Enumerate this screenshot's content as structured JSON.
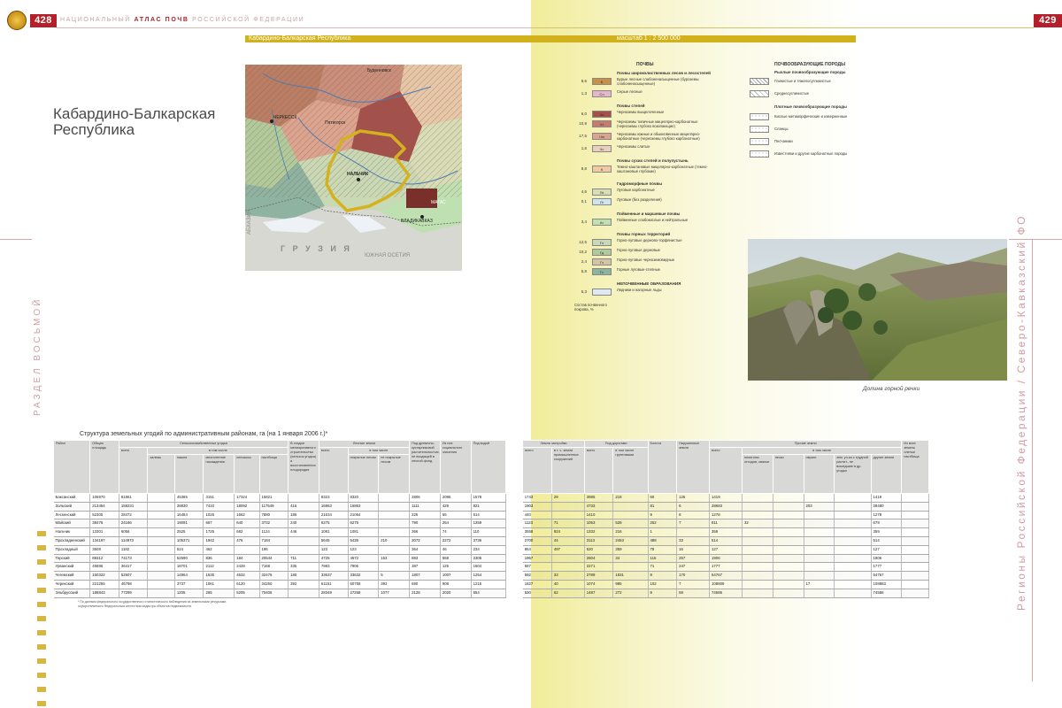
{
  "header": {
    "left_page_number": "428",
    "right_page_number": "429",
    "running_head_pre": "НАЦИОНАЛЬНЫЙ",
    "running_head_bold": "АТЛАС ПОЧВ",
    "running_head_post": "РОССИЙСКОЙ ФЕДЕРАЦИИ"
  },
  "map_bar": {
    "title": "Кабардино-Балкарская Республика",
    "scale": "масштаб 1 : 2 500 000"
  },
  "region_title": "Кабардино-Балкарская Республика",
  "map": {
    "labels": {
      "grusia": "Г Р У З И Я",
      "south_ossetia": "ЮЖНАЯ ОСЕТИЯ",
      "abkhazia": "АБХАЗИЯ",
      "nalchik": "НАЛЬЧИК",
      "cherkessk": "ЧЕРКЕССК",
      "vladikavkaz": "ВЛАДИКАВКАЗ",
      "pyatigorsk": "Пятигорск",
      "budennovsk": "Буденновск",
      "magas": "МАГАС"
    }
  },
  "legend": {
    "title": "ПОЧВЫ",
    "sections": [
      {
        "head": "Почвы широколиственных лесов и лесостепей",
        "items": [
          {
            "num": "8,6",
            "code": "Б",
            "color": "#c98f42",
            "text": "Бурые лесные слабоненасыщенные (буроземы слабоненасыщенные)"
          },
          {
            "num": "1,3",
            "code": "Сл",
            "color": "#e6b7cc",
            "text": "Серые лесные"
          }
        ]
      },
      {
        "head": "Почвы степей",
        "items": [
          {
            "num": "6,0",
            "code": "Чв",
            "color": "#a4514c",
            "text": "Черноземы выщелоченные"
          },
          {
            "num": "10,9",
            "code": "Чт",
            "color": "#c77b6e",
            "text": "Черноземы типичные мицелярно-карбонатные (черноземы глубоко вскипающие)"
          },
          {
            "num": "17,5",
            "code": "Чю",
            "color": "#dba48e",
            "text": "Черноземы южные и обыкновенные мицелярно-карбонатные (черноземы глубоко карбонатные)"
          },
          {
            "num": "1,5",
            "code": "Чс",
            "color": "#ead0bb",
            "text": "Черноземы слитые"
          }
        ]
      },
      {
        "head": "Почвы сухих степей и полупустынь",
        "items": [
          {
            "num": "8,8",
            "code": "К",
            "color": "#f1c9a3",
            "text": "Темно-каштановые мицелярно-карбонатные (темно-каштановые глубокие)"
          }
        ]
      },
      {
        "head": "Гидроморфные почвы",
        "items": [
          {
            "num": "4,6",
            "code": "Лк",
            "color": "#d7ddb7",
            "text": "Луговые карбонатные"
          },
          {
            "num": "0,1",
            "code": "Лг",
            "color": "#cfe4ee",
            "text": "Луговые (без разделения)"
          }
        ]
      },
      {
        "head": "Пойменные и маршевые почвы",
        "items": [
          {
            "num": "3,4",
            "code": "Аг",
            "color": "#bfe0b0",
            "text": "Пойменные слабокислые и нейтральные"
          }
        ]
      },
      {
        "head": "Почвы горных территорий",
        "items": [
          {
            "num": "12,5",
            "code": "Гл",
            "color": "#c9d9b6",
            "text": "Горно-луговые дерново-торфянистые"
          },
          {
            "num": "10,2",
            "code": "Гд",
            "color": "#b0ca9c",
            "text": "Горно-луговые дерновые"
          },
          {
            "num": "2,4",
            "code": "Гч",
            "color": "#d4c6a4",
            "text": "Горно-луговые черноземовидные"
          },
          {
            "num": "5,9",
            "code": "Гс",
            "color": "#8eb3a1",
            "text": "Горные луговые-степные"
          }
        ]
      },
      {
        "head": "НЕПОЧВЕННЫЕ ОБРАЗОВАНИЯ",
        "items": [
          {
            "num": "5,3",
            "code": "",
            "color": "#dfe9f3",
            "text": "Ледники и нагорные льды"
          }
        ]
      }
    ],
    "note": "Состав почвенного покрова, %",
    "right_title": "ПОЧВООБРАЗУЮЩИЕ ПОРОДЫ",
    "right_sub1": "Рыхлые почвообразующие породы",
    "right_items_1": [
      "Глинистые и тяжелосуглинистые",
      "Среднесуглинистые"
    ],
    "right_sub2": "Плотные почвообразующие породы",
    "right_items_2": [
      "Кислые метаморфические и изверженные",
      "Сланцы",
      "Песчаники",
      "Известняки и другие карбонатные породы"
    ]
  },
  "photo": {
    "caption": "Долина горной речки"
  },
  "side": {
    "left": "РАЗДЕЛ ВОСЬМОЙ",
    "right": "Регионы Российской Федерации / Северо-Кавказский ФО"
  },
  "table": {
    "caption": "Структура земельных угодий по административным районам, га (на 1 января 2006 г.)*",
    "headers": {
      "district": "Район",
      "total_area": "Общая площадь",
      "agri": "Сельскохозяйственные угодья",
      "agri_total": "всего",
      "incl": "в том числе",
      "arable": "пашня",
      "fallow": "залежь",
      "perennial": "многолетние насаждения",
      "hayfields": "сенокосы",
      "pastures": "пастбища",
      "construction": "В стадии мелиоративного строительства (сельхоз-угодья) и восстановления плодородия",
      "forest": "Лесные земли",
      "forest_total": "всего",
      "forest_covered": "покрытые лесом",
      "forest_not": "не покрытые лесом",
      "shrubs": "Под древесно-кустарниковой растительностью, не входящей в лесной фонд",
      "social": "Из них социального значения",
      "water": "Под водой",
      "built": "Земли застройки",
      "built_total": "всего",
      "built_industrial": "в т. ч. земли промышленных сооружений",
      "roads": "Под дорогами",
      "roads_total": "всего",
      "roads_dirt": "в том числе грунтовыми",
      "swamps": "Болота",
      "disturbed": "Нарушенные земли",
      "other": "Прочие земли",
      "other_total": "всего",
      "sands": "пески",
      "ravines": "овраги",
      "other_misc": "полигоны отходов, свалки",
      "eroded": "зем. уч-ки с трудной растит., не вошедшие в др. угодья",
      "other_land": "другие земли",
      "all_land": "Из всех земель оленьи пастбища"
    },
    "rows": [
      [
        "Баксанский",
        "106970",
        "81861",
        "",
        "45385",
        "3151",
        "17324",
        "15821",
        "",
        "8323",
        "8320",
        "",
        "2806",
        "2086",
        "1578",
        "",
        "1743",
        "29",
        "3985",
        "218",
        "60",
        "126",
        "1419",
        "",
        "",
        "",
        "",
        "1419",
        ""
      ],
      [
        "Зольский",
        "213454",
        "159231",
        "",
        "28830",
        "7410",
        "18092",
        "117549",
        "416",
        "16863",
        "16863",
        "",
        "1111",
        "429",
        "821",
        "",
        "1903",
        "",
        "4733",
        "",
        "81",
        "6",
        "28683",
        "",
        "",
        "203",
        "",
        "28480",
        ""
      ],
      [
        "Лескенский",
        "52305",
        "28472",
        "",
        "16484",
        "1026",
        "1662",
        "7880",
        "186",
        "21634",
        "21064",
        "",
        "225",
        "55",
        "614",
        "",
        "440",
        "",
        "1410",
        "",
        "9",
        "8",
        "1278",
        "",
        "",
        "",
        "",
        "1278",
        ""
      ],
      [
        "Майский",
        "38476",
        "24166",
        "",
        "19091",
        "667",
        "640",
        "3732",
        "240",
        "6275",
        "6275",
        "",
        "790",
        "254",
        "1259",
        "",
        "1123",
        "71",
        "1053",
        "528",
        "252",
        "7",
        "811",
        "32",
        "",
        "",
        "",
        "679",
        ""
      ],
      [
        "Нальчик",
        "13301",
        "6056",
        "",
        "2525",
        "1725",
        "682",
        "1124",
        "446",
        "1081",
        "1081",
        "",
        "366",
        "74",
        "110",
        "",
        "3558",
        "924",
        "1332",
        "216",
        "1",
        "",
        "359",
        "",
        "",
        "",
        "",
        "359",
        ""
      ],
      [
        "Прохладненский",
        "134197",
        "114973",
        "",
        "105371",
        "1942",
        "476",
        "7184",
        "",
        "5645",
        "5435",
        "210",
        "3072",
        "2272",
        "3736",
        "",
        "2700",
        "44",
        "3113",
        "2453",
        "488",
        "33",
        "514",
        "",
        "",
        "",
        "",
        "514",
        ""
      ],
      [
        "Прохладный",
        "3508",
        "1182",
        "",
        "524",
        "462",
        "",
        "196",
        "",
        "123",
        "123",
        "",
        "364",
        "46",
        "234",
        "",
        "864",
        "497",
        "520",
        "359",
        "78",
        "16",
        "127",
        "",
        "",
        "",
        "",
        "127",
        ""
      ],
      [
        "Терский",
        "89312",
        "74173",
        "",
        "52590",
        "836",
        "184",
        "20544",
        "711",
        "4725",
        "4572",
        "153",
        "883",
        "558",
        "2306",
        "",
        "1967",
        "",
        "2604",
        "34",
        "116",
        "257",
        "1906",
        "",
        "",
        "",
        "",
        "1906",
        ""
      ],
      [
        "Урванский",
        "45886",
        "36417",
        "",
        "18701",
        "2112",
        "2428",
        "7168",
        "335",
        "7983",
        "7906",
        "",
        "387",
        "125",
        "1604",
        "",
        "587",
        "",
        "2271",
        "",
        "71",
        "247",
        "1777",
        "",
        "",
        "",
        "",
        "1777",
        ""
      ],
      [
        "Чегемский",
        "150322",
        "52607",
        "",
        "14964",
        "1535",
        "4632",
        "32476",
        "180",
        "33637",
        "33632",
        "5",
        "1807",
        "1007",
        "1254",
        "",
        "592",
        "33",
        "2789",
        "1831",
        "9",
        "170",
        "54767",
        "",
        "",
        "",
        "",
        "54767",
        ""
      ],
      [
        "Черекский",
        "221255",
        "46798",
        "",
        "3737",
        "1061",
        "6120",
        "34250",
        "392",
        "61151",
        "60758",
        "393",
        "690",
        "908",
        "1215",
        "",
        "1827",
        "40",
        "1074",
        "985",
        "102",
        "7",
        "108809",
        "",
        "",
        "17",
        "",
        "108883",
        ""
      ],
      [
        "Эльбрусский",
        "186843",
        "77299",
        "",
        "1205",
        "265",
        "5205",
        "70406",
        "",
        "28349",
        "27268",
        "1077",
        "2128",
        "2020",
        "654",
        "",
        "530",
        "62",
        "1487",
        "272",
        "9",
        "59",
        "74586",
        "",
        "",
        "",
        "",
        "74586",
        ""
      ]
    ],
    "footnote": "* По данным федерального государственного статистического наблюдения за земельными ресурсами, осуществляемого Федеральным агентством кадастра объектов недвижимости"
  }
}
